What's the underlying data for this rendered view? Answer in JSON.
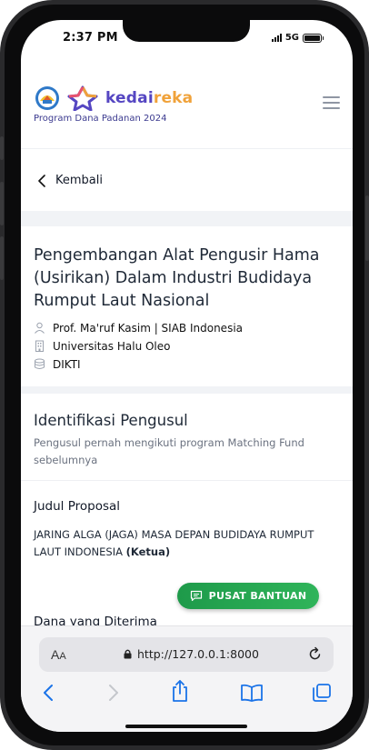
{
  "status": {
    "time": "2:37 PM",
    "network": "5G"
  },
  "header": {
    "brand_main": "kedai",
    "brand_accent": "reka",
    "subtitle": "Program Dana Padanan 2024"
  },
  "nav": {
    "back_label": "Kembali"
  },
  "project": {
    "title": "Pengembangan Alat Pengusir Hama (Usirikan) Dalam Industri Budidaya Rumput Laut Nasional",
    "person": "Prof. Ma'ruf Kasim | SIAB Indonesia",
    "university": "Universitas Halu Oleo",
    "institution": "DIKTI"
  },
  "identification": {
    "title": "Identifikasi Pengusul",
    "description": "Pengusul pernah mengikuti program Matching Fund sebelumnya",
    "proposal_label": "Judul Proposal",
    "proposal_value": "JARING ALGA (JAGA) MASA DEPAN BUDIDAYA RUMPUT LAUT INDONESIA",
    "proposal_role": "(Ketua)",
    "funds_label": "Dana yang Diterima"
  },
  "help": {
    "label": "PUSAT BANTUAN"
  },
  "browser": {
    "aa_large": "A",
    "aa_small": "A",
    "url": "http://127.0.0.1:8000"
  },
  "colors": {
    "brand_purple": "#5546c2",
    "brand_orange": "#f0a23a",
    "help_green": "#1e9a4a",
    "ios_blue": "#1a73e8"
  }
}
